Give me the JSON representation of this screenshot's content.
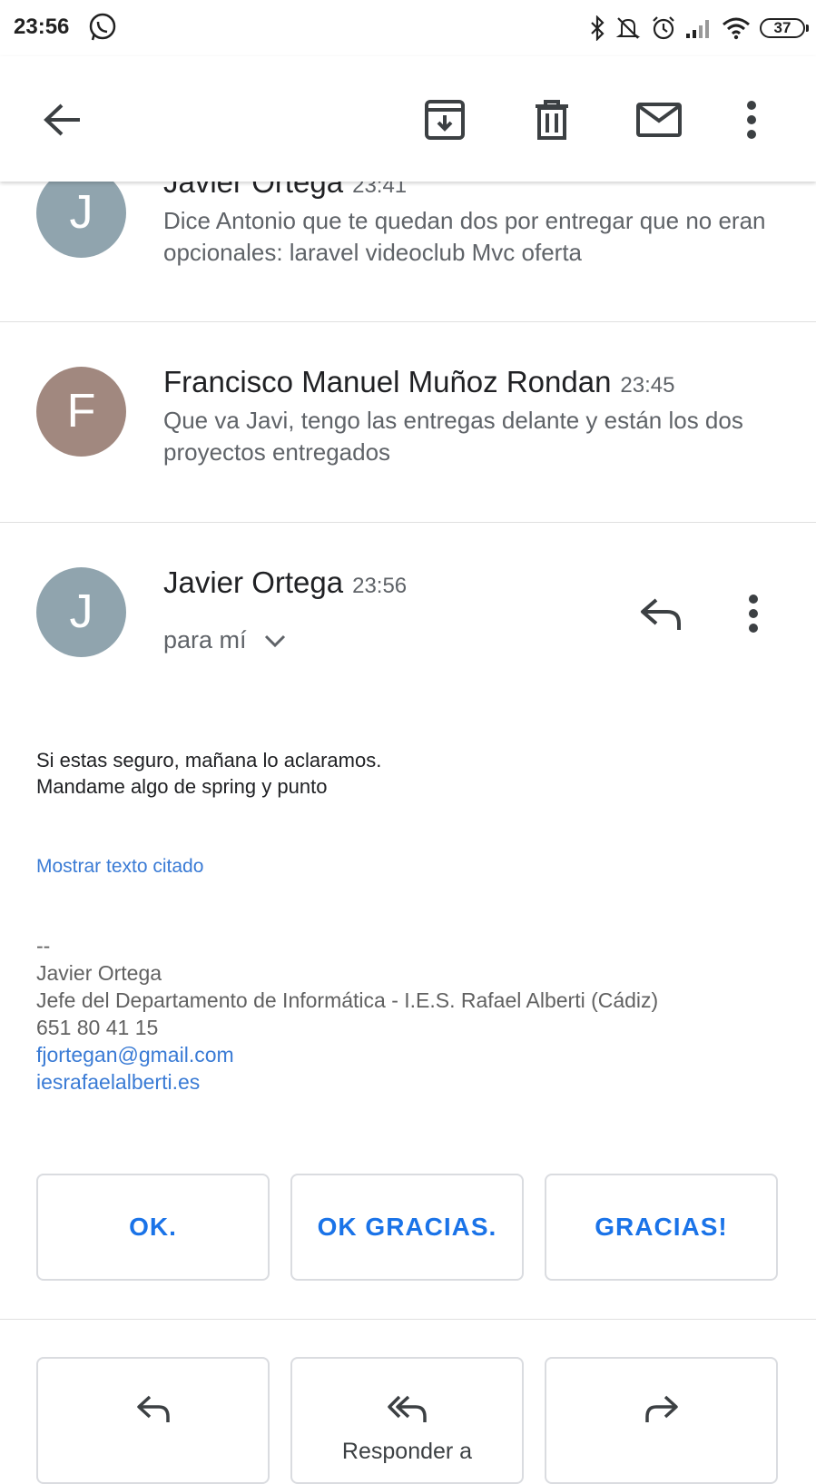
{
  "status_bar": {
    "time": "23:56",
    "battery": "37",
    "icons": [
      "whatsapp-icon",
      "bluetooth-icon",
      "mute-icon",
      "alarm-icon",
      "signal-icon",
      "wifi-icon",
      "battery-icon"
    ]
  },
  "toolbar": {
    "icons": [
      "back-arrow-icon",
      "archive-icon",
      "delete-icon",
      "mark-unread-icon",
      "more-options-icon"
    ]
  },
  "messages": [
    {
      "initial": "J",
      "avatar_color": "#90a4ae",
      "sender": "Javier Ortega",
      "time": "23:41",
      "snippet": "Dice Antonio que te quedan dos por entregar que no eran opcionales: laravel videoclub Mvc oferta"
    },
    {
      "initial": "F",
      "avatar_color": "#a1887f",
      "sender": "Francisco Manuel Muñoz Rondan",
      "time": "23:45",
      "snippet": "Que va Javi, tengo las entregas delante y están los dos proyectos entregados"
    }
  ],
  "open_message": {
    "initial": "J",
    "avatar_color": "#90a4ae",
    "sender": "Javier Ortega",
    "time": "23:56",
    "recipient": "para mí",
    "body_line1": "Si estas seguro, mañana lo aclaramos.",
    "body_line2": "Mandame algo de spring y punto",
    "show_quoted": "Mostrar texto citado",
    "signature": {
      "separator": "--",
      "name": "Javier Ortega",
      "title": "Jefe del Departamento de Informática - I.E.S. Rafael Alberti (Cádiz)",
      "phone": "651 80 41 15",
      "email": "fjortegan@gmail.com",
      "website": "iesrafaelalberti.es"
    }
  },
  "smart_replies": [
    "OK.",
    "OK GRACIAS.",
    "GRACIAS!"
  ],
  "actions": [
    {
      "icon": "reply-icon",
      "label": ""
    },
    {
      "icon": "reply-all-icon",
      "label": "Responder a"
    },
    {
      "icon": "forward-icon",
      "label": ""
    }
  ],
  "colors": {
    "accent": "#1a73e8",
    "link": "#3a7bd5"
  }
}
